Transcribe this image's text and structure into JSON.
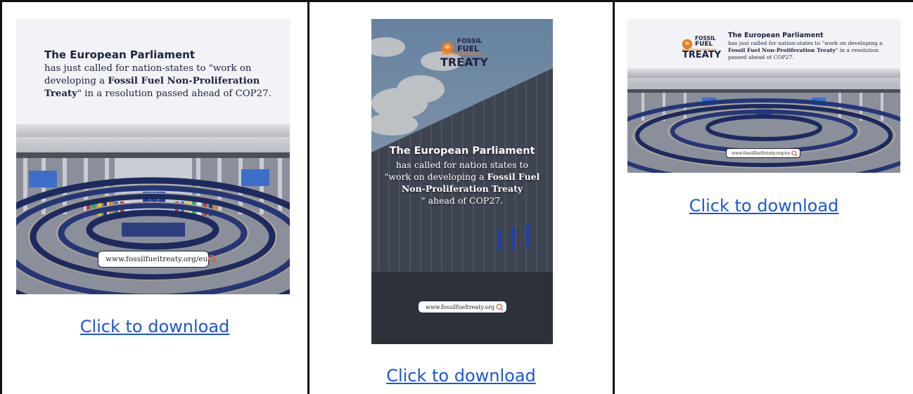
{
  "cards": [
    {
      "heading": "The European Parliament",
      "body_lines": [
        "has just called for nation-states to \"work on",
        "developing a ",
        "Fossil Fuel Non-Proliferation",
        "Treaty",
        "\" in a resolution passed ahead of COP27."
      ],
      "search_text": "www.fossilfueltreaty.org/eu",
      "download_label": "Click to download"
    },
    {
      "logo_line1": "FOSSIL",
      "logo_line2": "FUEL",
      "logo_sub": "NON-PROLIFERATION",
      "logo_line3": "TREATY",
      "heading": "The European Parliament",
      "body_a": "has called for nation states to",
      "body_b": "\"work on developing a ",
      "body_bold": "Fossil Fuel Non-Proliferation Treaty",
      "body_c": "\" ahead of COP27.",
      "search_text": "www.fossilfueltreaty.org",
      "download_label": "Click to download"
    },
    {
      "logo_line1": "FOSSIL",
      "logo_line2": "FUEL",
      "logo_sub": "NON-PROLIFERATION",
      "logo_line3": "TREATY",
      "heading": "The European Parliament",
      "body_a": "has just called for nation-states to \"work on developing a ",
      "body_bold": "Fossil Fuel Non-Proliferation Treaty",
      "body_c": "\" in a resolution passed ahead of COP27.",
      "search_text": "www.fossilfueltreaty.org/eu",
      "download_label": "Click to download"
    }
  ],
  "colors": {
    "link": "#1a56db",
    "navy": "#1d2240",
    "orange": "#f07c1e",
    "border": "#111111"
  },
  "icons": [
    "search-icon",
    "globe-flame-icon"
  ]
}
